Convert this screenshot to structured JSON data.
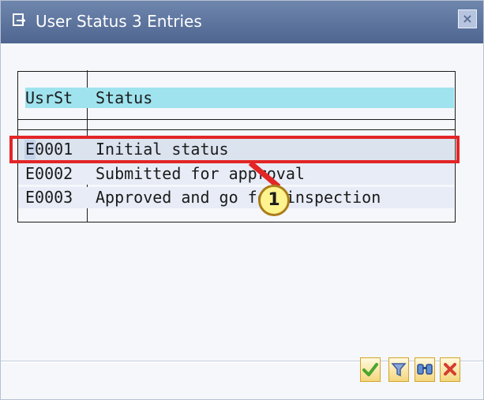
{
  "window": {
    "title": "User Status 3 Entries"
  },
  "table": {
    "headers": {
      "code": "UsrSt",
      "status": "Status"
    },
    "rows": [
      {
        "code": "E0001",
        "status": "Initial status"
      },
      {
        "code": "E0002",
        "status": "Submitted for approval"
      },
      {
        "code": "E0003",
        "status": "Approved and go for inspection"
      }
    ]
  },
  "annotation": {
    "number": "1"
  },
  "toolbar": {
    "buttons": [
      "check-icon",
      "filter-icon",
      "find-icon",
      "cancel-icon"
    ]
  },
  "colors": {
    "title_bar": "#5f759f",
    "header_fill": "#9fe3ee",
    "highlight": "#e32526",
    "badge_fill": "#fff38f"
  }
}
